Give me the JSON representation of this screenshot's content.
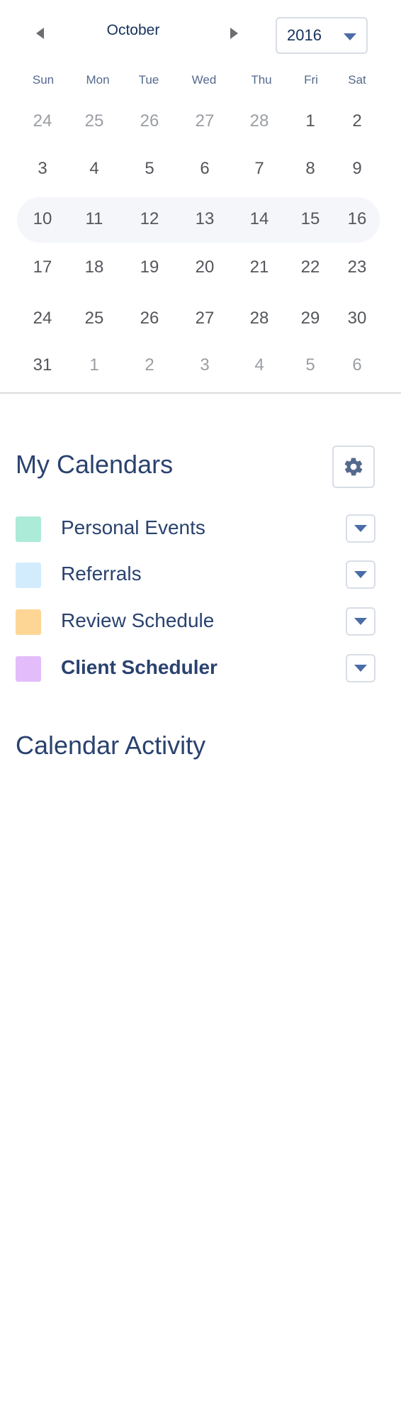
{
  "calendar": {
    "month": "October",
    "year": "2016",
    "weekdays": [
      "Sun",
      "Mon",
      "Tue",
      "Wed",
      "Thu",
      "Fri",
      "Sat"
    ],
    "weeks": [
      [
        "24",
        "25",
        "26",
        "27",
        "28",
        "1",
        "2"
      ],
      [
        "3",
        "4",
        "5",
        "6",
        "7",
        "8",
        "9"
      ],
      [
        "10",
        "11",
        "12",
        "13",
        "14",
        "15",
        "16"
      ],
      [
        "17",
        "18",
        "19",
        "20",
        "21",
        "22",
        "23"
      ],
      [
        "24",
        "25",
        "26",
        "27",
        "28",
        "29",
        "30"
      ],
      [
        "31",
        "1",
        "2",
        "3",
        "4",
        "5",
        "6"
      ]
    ],
    "highlighted_week": 2
  },
  "my_calendars": {
    "title": "My Calendars",
    "items": [
      {
        "label": "Personal Events",
        "color": "#acebd8"
      },
      {
        "label": "Referrals",
        "color": "#d3ecfd"
      },
      {
        "label": "Review Schedule",
        "color": "#fdd696"
      },
      {
        "label": "Client Scheduler",
        "color": "#e3bdfa"
      }
    ]
  },
  "calendar_activity": {
    "title": "Calendar Activity"
  },
  "colors": {
    "text_dark": "#2a426f",
    "accent": "#4a6ca8",
    "border": "#d8dde6",
    "highlight_row": "#f4f6f9"
  }
}
